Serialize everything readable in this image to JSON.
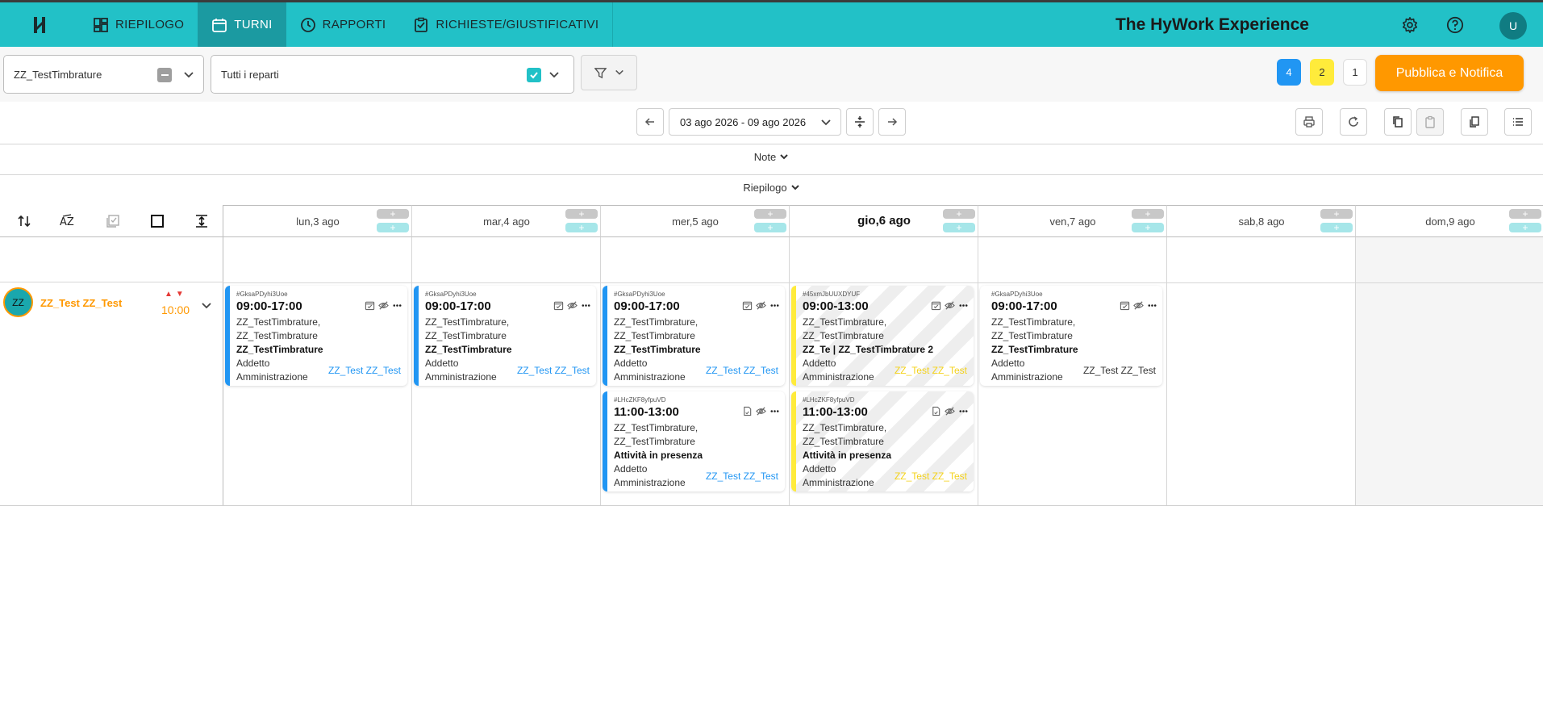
{
  "nav": {
    "items": [
      {
        "label": "RIEPILOGO",
        "icon": "dashboard-icon"
      },
      {
        "label": "TURNI",
        "icon": "calendar-icon"
      },
      {
        "label": "RAPPORTI",
        "icon": "clock-icon"
      },
      {
        "label": "RICHIESTE/GIUSTIFICATIVI",
        "icon": "checklist-icon"
      }
    ],
    "brand": "The HyWork Experience",
    "user_initial": "U"
  },
  "filters": {
    "company": "ZZ_TestTimbrature",
    "departments": "Tutti i reparti"
  },
  "badges": {
    "blue": "4",
    "yellow": "2",
    "white": "1"
  },
  "publish_label": "Pubblica e Notifica",
  "date_range": "03 ago 2026 - 09 ago 2026",
  "sections": {
    "note": "Note",
    "riepilogo": "Riepilogo"
  },
  "days": [
    "lun,3 ago",
    "mar,4 ago",
    "mer,5 ago",
    "gio,6 ago",
    "ven,7 ago",
    "sab,8 ago",
    "dom,9 ago"
  ],
  "today_index": 3,
  "employee": {
    "initials": "ZZ",
    "name": "ZZ_Test ZZ_Test",
    "hours": "10:00"
  },
  "colors": {
    "teal": "#22c1c7",
    "orange": "#ff9800",
    "blue": "#2196f3",
    "yellow": "#ffeb3b"
  },
  "shifts": [
    {
      "day": 0,
      "slot": 0,
      "code": "#GksaPDyhi3Uoe",
      "time": "09:00-17:00",
      "line1": "ZZ_TestTimbrature,",
      "line2": "ZZ_TestTimbrature",
      "place": "ZZ_TestTimbrature",
      "role1": "Addetto",
      "role2": "Amministrazione",
      "who": "ZZ_Test ZZ_Test",
      "color": "blue"
    },
    {
      "day": 1,
      "slot": 0,
      "code": "#GksaPDyhi3Uoe",
      "time": "09:00-17:00",
      "line1": "ZZ_TestTimbrature,",
      "line2": "ZZ_TestTimbrature",
      "place": "ZZ_TestTimbrature",
      "role1": "Addetto",
      "role2": "Amministrazione",
      "who": "ZZ_Test ZZ_Test",
      "color": "blue"
    },
    {
      "day": 2,
      "slot": 0,
      "code": "#GksaPDyhi3Uoe",
      "time": "09:00-17:00",
      "line1": "ZZ_TestTimbrature,",
      "line2": "ZZ_TestTimbrature",
      "place": "ZZ_TestTimbrature",
      "role1": "Addetto",
      "role2": "Amministrazione",
      "who": "ZZ_Test ZZ_Test",
      "color": "blue"
    },
    {
      "day": 2,
      "slot": 1,
      "code": "#LHcZKF8yfpuVD",
      "time": "11:00-13:00",
      "line1": "ZZ_TestTimbrature,",
      "line2": "ZZ_TestTimbrature",
      "place": "Attività in presenza",
      "role1": "Addetto",
      "role2": "Amministrazione",
      "who": "ZZ_Test ZZ_Test",
      "color": "blue"
    },
    {
      "day": 3,
      "slot": 0,
      "code": "#45xmJbUUXDYUF",
      "time": "09:00-13:00",
      "line1": "ZZ_TestTimbrature,",
      "line2": "ZZ_TestTimbrature",
      "place": "ZZ_Te | ZZ_TestTimbrature 2",
      "role1": "Addetto",
      "role2": "Amministrazione",
      "who": "ZZ_Test ZZ_Test",
      "color": "yellow"
    },
    {
      "day": 3,
      "slot": 1,
      "code": "#LHcZKF8yfpuVD",
      "time": "11:00-13:00",
      "line1": "ZZ_TestTimbrature,",
      "line2": "ZZ_TestTimbrature",
      "place": "Attività in presenza",
      "role1": "Addetto",
      "role2": "Amministrazione",
      "who": "ZZ_Test ZZ_Test",
      "color": "yellow"
    },
    {
      "day": 4,
      "slot": 0,
      "code": "#GksaPDyhi3Uoe",
      "time": "09:00-17:00",
      "line1": "ZZ_TestTimbrature,",
      "line2": "ZZ_TestTimbrature",
      "place": "ZZ_TestTimbrature",
      "role1": "Addetto",
      "role2": "Amministrazione",
      "who": "ZZ_Test ZZ_Test",
      "color": "none"
    }
  ]
}
